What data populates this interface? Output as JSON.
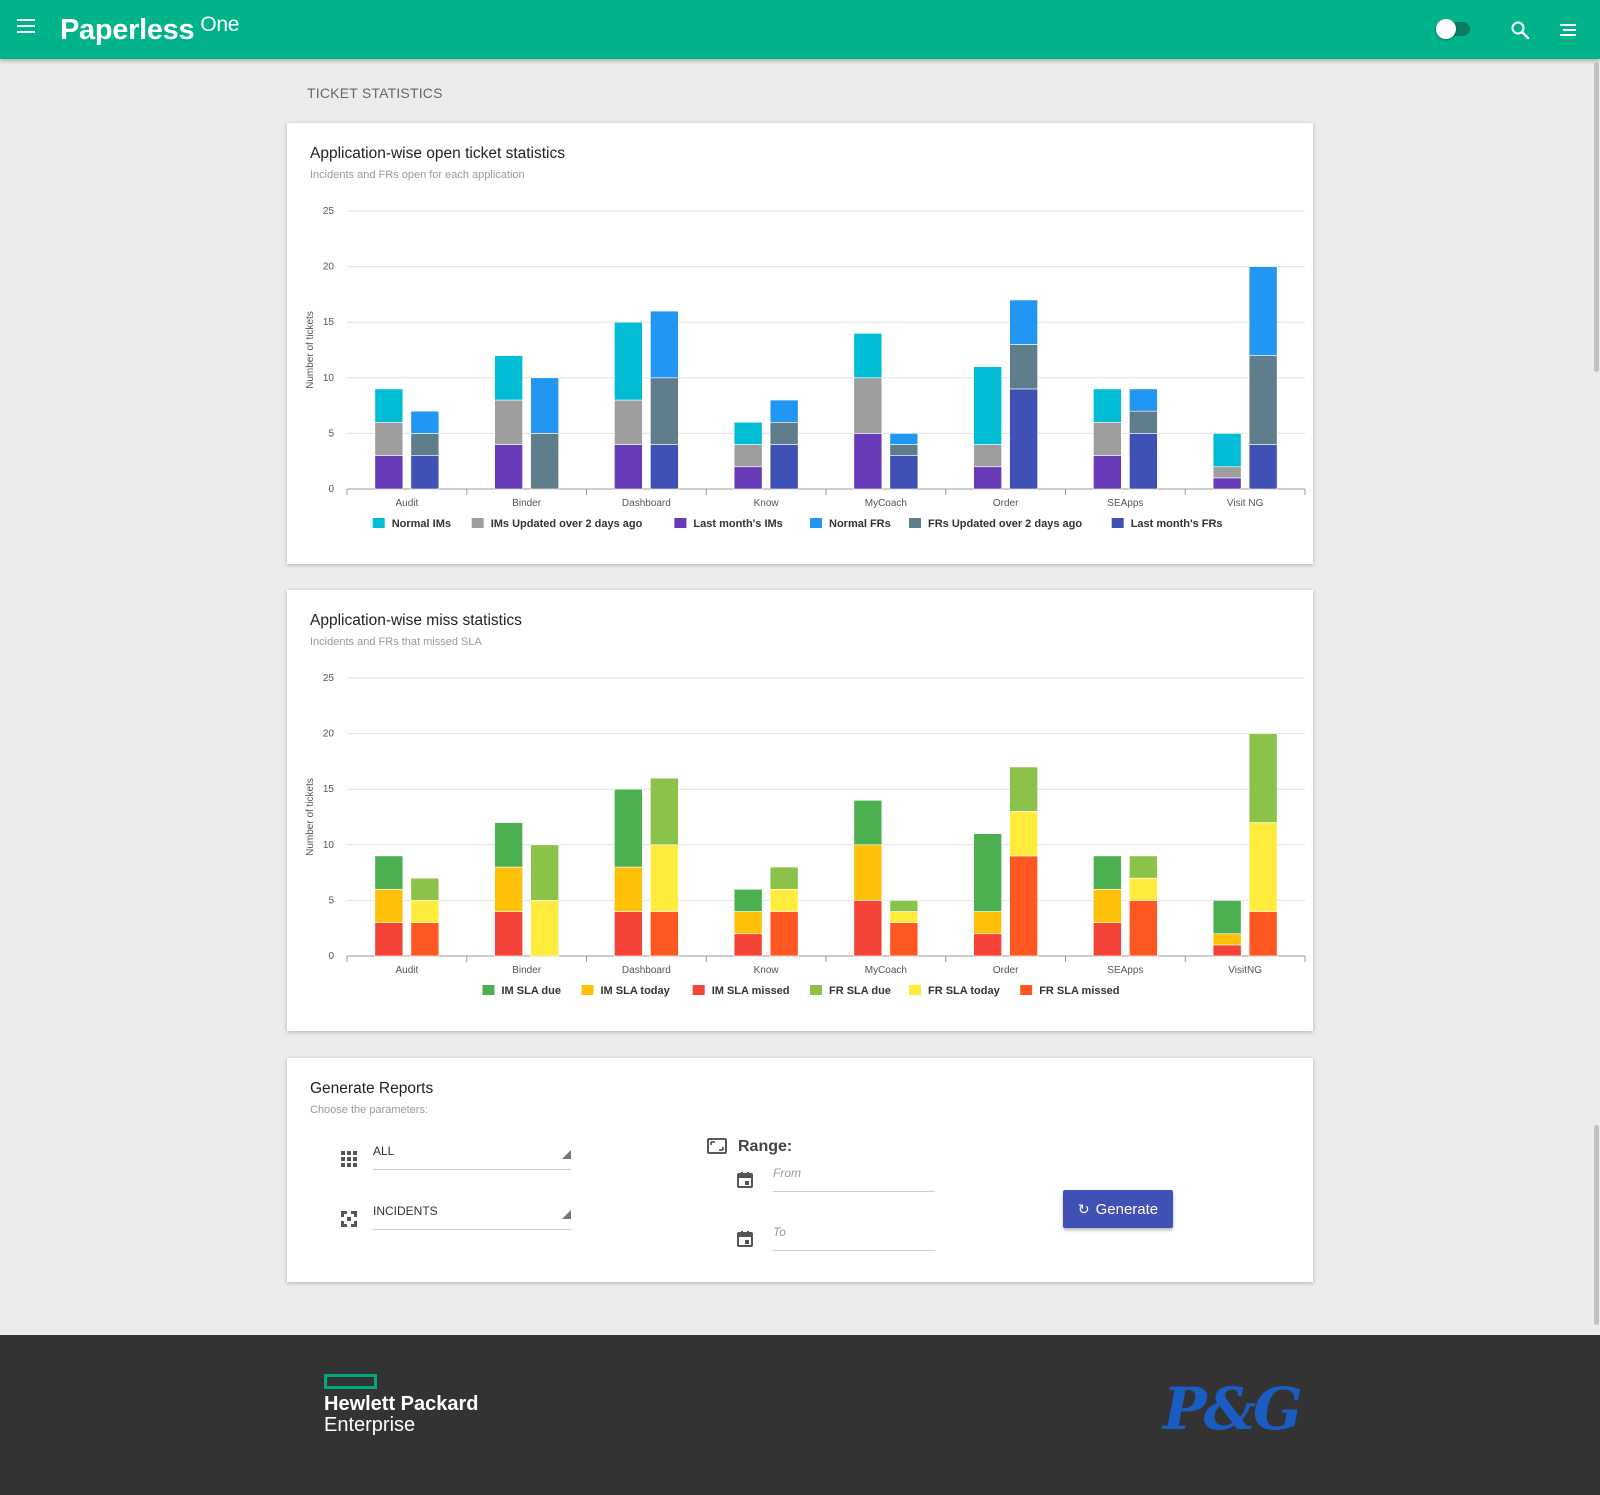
{
  "app": {
    "brand": "Paperless",
    "brand_sup": "One"
  },
  "header": {
    "toggle_state": "off"
  },
  "page": {
    "section_title": "TICKET STATISTICS"
  },
  "open_card": {
    "title": "Application-wise open ticket statistics",
    "subtitle": "Incidents and FRs open for each application"
  },
  "miss_card": {
    "title": "Application-wise miss statistics",
    "subtitle": "Incidents and FRs that missed SLA"
  },
  "chart_data": [
    {
      "type": "bar",
      "stacked": true,
      "ylabel": "Number of tickets",
      "ylim": [
        0,
        25
      ],
      "yticks": [
        0,
        5,
        10,
        15,
        20,
        25
      ],
      "categories": [
        "Audit",
        "Binder",
        "Dashboard",
        "Know",
        "MyCoach",
        "Order",
        "SEApps",
        "Visit NG"
      ],
      "legend_position": "bottom",
      "series": [
        {
          "name": "Normal IMs",
          "stack": "IM",
          "color": "#00bcd4",
          "values": [
            3,
            4,
            7,
            2,
            4,
            7,
            3,
            3
          ]
        },
        {
          "name": "IMs Updated over 2 days ago",
          "stack": "IM",
          "color": "#9e9e9e",
          "values": [
            3,
            4,
            4,
            2,
            5,
            2,
            3,
            1
          ]
        },
        {
          "name": "Last month's IMs",
          "stack": "IM",
          "color": "#673ab7",
          "values": [
            3,
            4,
            4,
            2,
            5,
            2,
            3,
            1
          ]
        },
        {
          "name": "Normal FRs",
          "stack": "FR",
          "color": "#2196f3",
          "values": [
            2,
            5,
            6,
            2,
            1,
            4,
            2,
            8
          ]
        },
        {
          "name": "FRs Updated over 2 days ago",
          "stack": "FR",
          "color": "#607d8b",
          "values": [
            2,
            5,
            6,
            2,
            1,
            4,
            2,
            8
          ]
        },
        {
          "name": "Last month's FRs",
          "stack": "FR",
          "color": "#3f51b5",
          "values": [
            3,
            0,
            4,
            4,
            3,
            9,
            5,
            4
          ]
        }
      ]
    },
    {
      "type": "bar",
      "stacked": true,
      "ylabel": "Number of tickets",
      "ylim": [
        0,
        25
      ],
      "yticks": [
        0,
        5,
        10,
        15,
        20,
        25
      ],
      "categories": [
        "Audit",
        "Binder",
        "Dashboard",
        "Know",
        "MyCoach",
        "Order",
        "SEApps",
        "VisitNG"
      ],
      "legend_position": "bottom",
      "series": [
        {
          "name": "IM SLA due",
          "stack": "IM",
          "color": "#4caf50",
          "values": [
            3,
            4,
            7,
            2,
            4,
            7,
            3,
            3
          ]
        },
        {
          "name": "IM SLA today",
          "stack": "IM",
          "color": "#ffc107",
          "values": [
            3,
            4,
            4,
            2,
            5,
            2,
            3,
            1
          ]
        },
        {
          "name": "IM SLA missed",
          "stack": "IM",
          "color": "#f44336",
          "values": [
            3,
            4,
            4,
            2,
            5,
            2,
            3,
            1
          ]
        },
        {
          "name": "FR SLA due",
          "stack": "FR",
          "color": "#8bc34a",
          "values": [
            2,
            5,
            6,
            2,
            1,
            4,
            2,
            8
          ]
        },
        {
          "name": "FR SLA today",
          "stack": "FR",
          "color": "#ffeb3b",
          "values": [
            2,
            5,
            6,
            2,
            1,
            4,
            2,
            8
          ]
        },
        {
          "name": "FR SLA missed",
          "stack": "FR",
          "color": "#ff5722",
          "values": [
            3,
            0,
            4,
            4,
            3,
            9,
            5,
            4
          ]
        }
      ]
    }
  ],
  "reports": {
    "title": "Generate Reports",
    "subtitle": "Choose the parameters:",
    "application_select": "ALL",
    "type_select": "INCIDENTS",
    "range_label": "Range:",
    "from_placeholder": "From",
    "to_placeholder": "To",
    "generate_label": "Generate",
    "generate_icon": "refresh-icon",
    "button_color": "#3f51b5"
  },
  "footer": {
    "hpe_line1": "Hewlett Packard",
    "hpe_line2": "Enterprise",
    "pg_logo": "P&G",
    "hpe_color": "#01a982",
    "pg_color": "#1a5dc2"
  },
  "colors": {
    "header": "#00b38a",
    "background": "#ececec",
    "footer": "#333333"
  }
}
